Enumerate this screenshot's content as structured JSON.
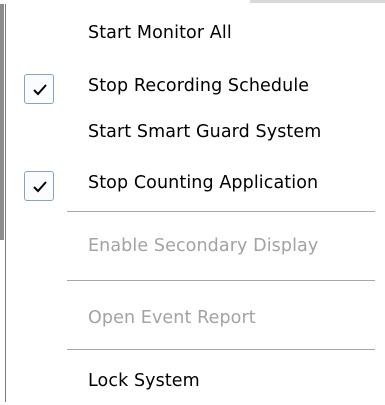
{
  "menu": {
    "items": [
      {
        "label": "Start Monitor All",
        "checked": false,
        "disabled": false
      },
      {
        "label": "Stop Recording Schedule",
        "checked": true,
        "disabled": false
      },
      {
        "label": "Start Smart Guard System",
        "checked": false,
        "disabled": false
      },
      {
        "label": "Stop Counting Application",
        "checked": true,
        "disabled": false
      },
      {
        "label": "Enable Secondary Display",
        "checked": false,
        "disabled": true
      },
      {
        "label": "Open Event Report",
        "checked": false,
        "disabled": true
      },
      {
        "label": "Lock System",
        "checked": false,
        "disabled": false
      }
    ]
  },
  "colors": {
    "check_border": "#8aa2be",
    "disabled_text": "#a3a3a3",
    "separator": "#a8a8a8"
  }
}
